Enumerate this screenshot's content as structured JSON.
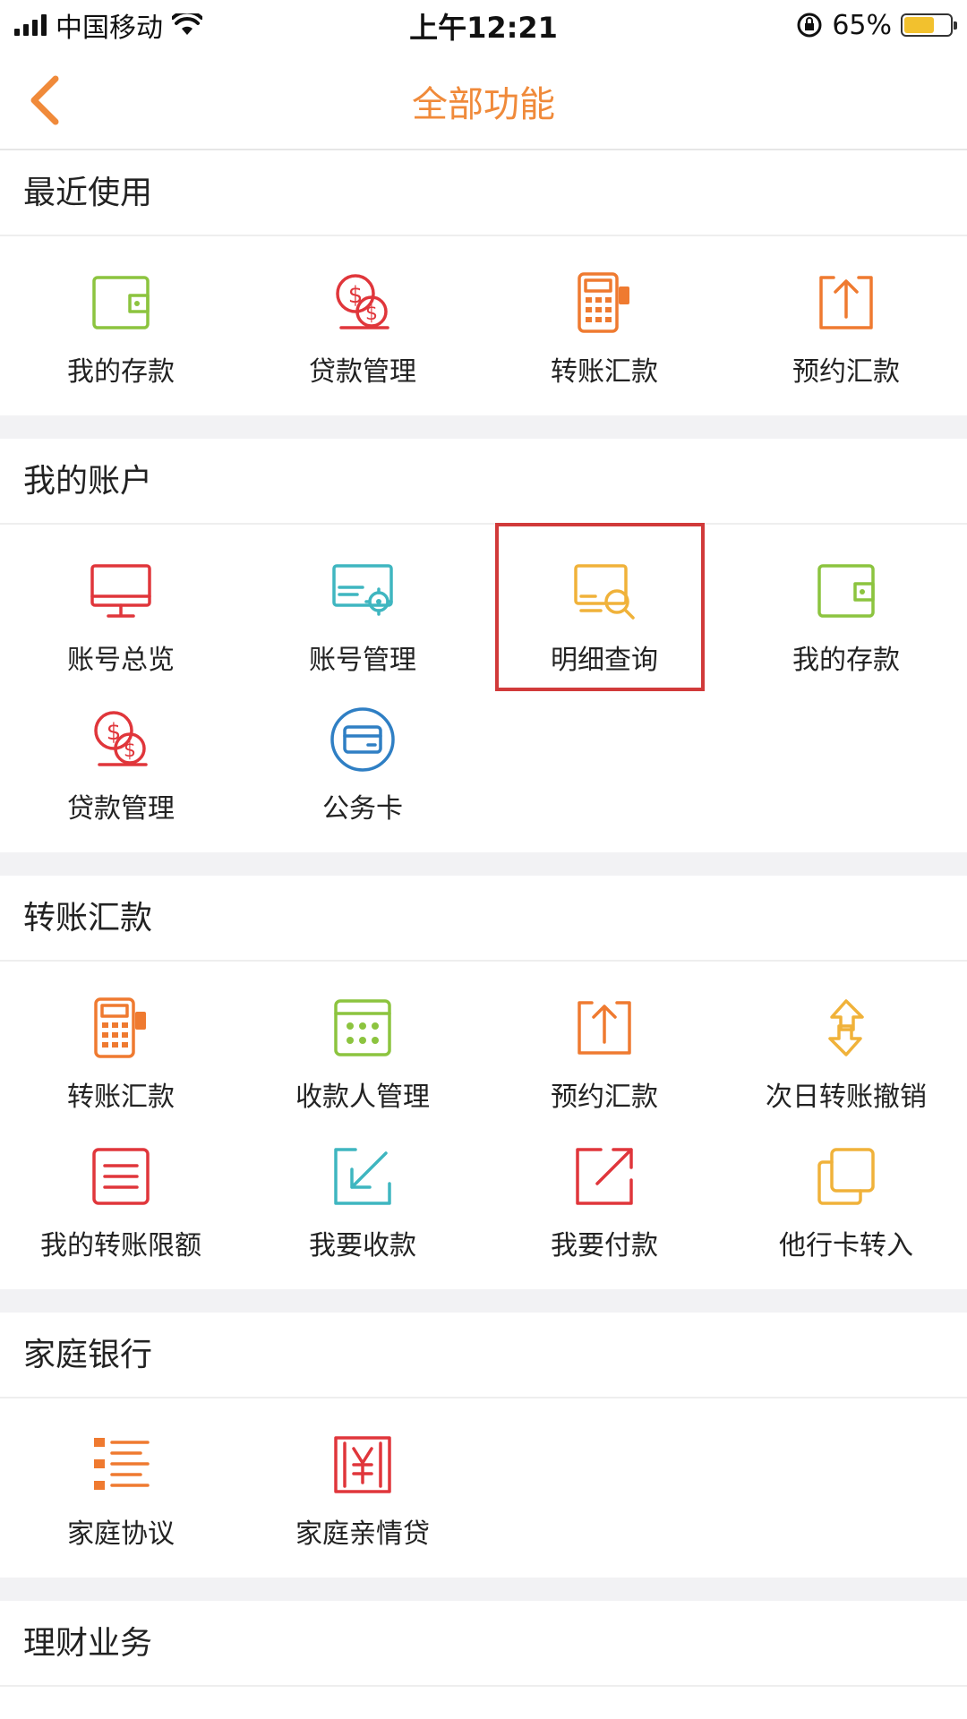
{
  "status_bar": {
    "carrier": "中国移动",
    "time": "上午12:21",
    "battery": "65%",
    "battery_level": 0.65
  },
  "nav": {
    "title": "全部功能",
    "back_icon": "chevron-left-icon"
  },
  "sections": {
    "recent": {
      "title": "最近使用",
      "items": [
        {
          "label": "我的存款",
          "icon": "wallet-icon",
          "color": "#8cc43f"
        },
        {
          "label": "贷款管理",
          "icon": "coins-icon",
          "color": "#e0363b"
        },
        {
          "label": "转账汇款",
          "icon": "pos-terminal-icon",
          "color": "#ef7a30"
        },
        {
          "label": "预约汇款",
          "icon": "upload-icon",
          "color": "#ef7a30"
        }
      ]
    },
    "account": {
      "title": "我的账户",
      "items": [
        {
          "label": "账号总览",
          "icon": "monitor-icon",
          "color": "#e0363b"
        },
        {
          "label": "账号管理",
          "icon": "monitor-gear-icon",
          "color": "#3fb6c0"
        },
        {
          "label": "明细查询",
          "icon": "monitor-search-icon",
          "color": "#f0b23a"
        },
        {
          "label": "我的存款",
          "icon": "wallet-icon",
          "color": "#8cc43f"
        },
        {
          "label": "贷款管理",
          "icon": "coins-icon",
          "color": "#e0363b"
        },
        {
          "label": "公务卡",
          "icon": "card-circle-icon",
          "color": "#2f7fc4"
        }
      ]
    },
    "transfer": {
      "title": "转账汇款",
      "items": [
        {
          "label": "转账汇款",
          "icon": "pos-terminal-icon",
          "color": "#ef7a30"
        },
        {
          "label": "收款人管理",
          "icon": "calendar-grid-icon",
          "color": "#8cc43f"
        },
        {
          "label": "预约汇款",
          "icon": "upload-icon",
          "color": "#ef7a30"
        },
        {
          "label": "次日转账撤销",
          "icon": "exchange-arrows-icon",
          "color": "#f0b23a"
        },
        {
          "label": "我的转账限额",
          "icon": "list-box-icon",
          "color": "#e0363b"
        },
        {
          "label": "我要收款",
          "icon": "arrow-in-icon",
          "color": "#3fb6c0"
        },
        {
          "label": "我要付款",
          "icon": "arrow-out-icon",
          "color": "#e0363b"
        },
        {
          "label": "他行卡转入",
          "icon": "copy-cards-icon",
          "color": "#f0b23a"
        }
      ]
    },
    "family": {
      "title": "家庭银行",
      "items": [
        {
          "label": "家庭协议",
          "icon": "list-lines-icon",
          "color": "#ef7a30"
        },
        {
          "label": "家庭亲情贷",
          "icon": "yen-box-icon",
          "color": "#e0363b"
        }
      ]
    },
    "finance": {
      "title": "理财业务"
    }
  }
}
